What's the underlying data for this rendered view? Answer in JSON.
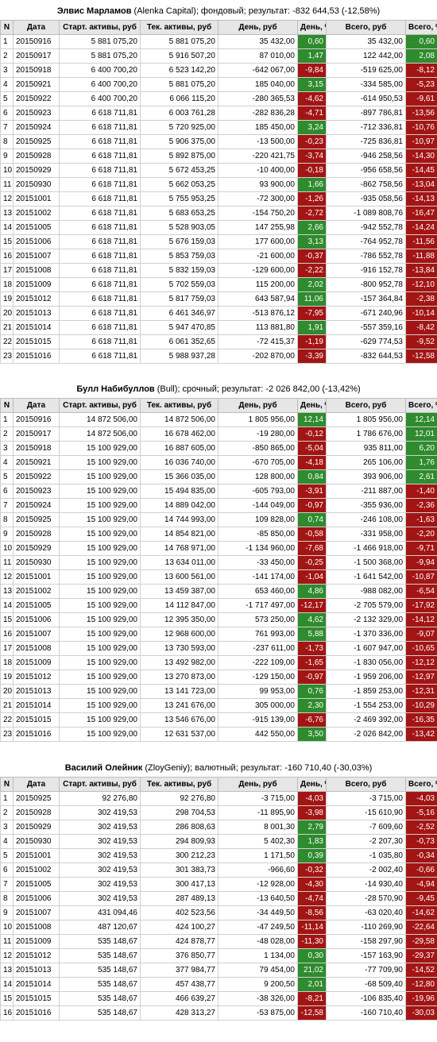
{
  "colors": {
    "positive": "#2e8b2e",
    "negative": "#a31515",
    "header_bg": "#e6e6e6"
  },
  "headers": [
    "N",
    "Дата",
    "Старт. активы, руб",
    "Тек. активы, руб",
    "День, руб",
    "День, %",
    "Всего, руб",
    "Всего, %"
  ],
  "sections": [
    {
      "name": "Элвис Марламов",
      "info": " (Alenka Capital); фондовый; результат: -832 644,53 (-12,58%)",
      "rows": [
        [
          "1",
          "20150916",
          "5 881 075,20",
          "5 881 075,20",
          "35 432,00",
          "0,60",
          "35 432,00",
          "0,60"
        ],
        [
          "2",
          "20150917",
          "5 881 075,20",
          "5 916 507,20",
          "87 010,00",
          "1,47",
          "122 442,00",
          "2,08"
        ],
        [
          "3",
          "20150918",
          "6 400 700,20",
          "6 523 142,20",
          "-642 067,00",
          "-9,84",
          "-519 625,00",
          "-8,12"
        ],
        [
          "4",
          "20150921",
          "6 400 700,20",
          "5 881 075,20",
          "185 040,00",
          "3,15",
          "-334 585,00",
          "-5,23"
        ],
        [
          "5",
          "20150922",
          "6 400 700,20",
          "6 066 115,20",
          "-280 365,53",
          "-4,62",
          "-614 950,53",
          "-9,61"
        ],
        [
          "6",
          "20150923",
          "6 618 711,81",
          "6 003 761,28",
          "-282 836,28",
          "-4,71",
          "-897 786,81",
          "-13,56"
        ],
        [
          "7",
          "20150924",
          "6 618 711,81",
          "5 720 925,00",
          "185 450,00",
          "3,24",
          "-712 336,81",
          "-10,76"
        ],
        [
          "8",
          "20150925",
          "6 618 711,81",
          "5 906 375,00",
          "-13 500,00",
          "-0,23",
          "-725 836,81",
          "-10,97"
        ],
        [
          "9",
          "20150928",
          "6 618 711,81",
          "5 892 875,00",
          "-220 421,75",
          "-3,74",
          "-946 258,56",
          "-14,30"
        ],
        [
          "10",
          "20150929",
          "6 618 711,81",
          "5 672 453,25",
          "-10 400,00",
          "-0,18",
          "-956 658,56",
          "-14,45"
        ],
        [
          "11",
          "20150930",
          "6 618 711,81",
          "5 662 053,25",
          "93 900,00",
          "1,66",
          "-862 758,56",
          "-13,04"
        ],
        [
          "12",
          "20151001",
          "6 618 711,81",
          "5 755 953,25",
          "-72 300,00",
          "-1,26",
          "-935 058,56",
          "-14,13"
        ],
        [
          "13",
          "20151002",
          "6 618 711,81",
          "5 683 653,25",
          "-154 750,20",
          "-2,72",
          "-1 089 808,76",
          "-16,47"
        ],
        [
          "14",
          "20151005",
          "6 618 711,81",
          "5 528 903,05",
          "147 255,98",
          "2,66",
          "-942 552,78",
          "-14,24"
        ],
        [
          "15",
          "20151006",
          "6 618 711,81",
          "5 676 159,03",
          "177 600,00",
          "3,13",
          "-764 952,78",
          "-11,56"
        ],
        [
          "16",
          "20151007",
          "6 618 711,81",
          "5 853 759,03",
          "-21 600,00",
          "-0,37",
          "-786 552,78",
          "-11,88"
        ],
        [
          "17",
          "20151008",
          "6 618 711,81",
          "5 832 159,03",
          "-129 600,00",
          "-2,22",
          "-916 152,78",
          "-13,84"
        ],
        [
          "18",
          "20151009",
          "6 618 711,81",
          "5 702 559,03",
          "115 200,00",
          "2,02",
          "-800 952,78",
          "-12,10"
        ],
        [
          "19",
          "20151012",
          "6 618 711,81",
          "5 817 759,03",
          "643 587,94",
          "11,06",
          "-157 364,84",
          "-2,38"
        ],
        [
          "20",
          "20151013",
          "6 618 711,81",
          "6 461 346,97",
          "-513 876,12",
          "-7,95",
          "-671 240,96",
          "-10,14"
        ],
        [
          "21",
          "20151014",
          "6 618 711,81",
          "5 947 470,85",
          "113 881,80",
          "1,91",
          "-557 359,16",
          "-8,42"
        ],
        [
          "22",
          "20151015",
          "6 618 711,81",
          "6 061 352,65",
          "-72 415,37",
          "-1,19",
          "-629 774,53",
          "-9,52"
        ],
        [
          "23",
          "20151016",
          "6 618 711,81",
          "5 988 937,28",
          "-202 870,00",
          "-3,39",
          "-832 644,53",
          "-12,58"
        ]
      ]
    },
    {
      "name": "Булл Набибуллов",
      "info": " (Bull); срочный; результат: -2 026 842,00 (-13,42%)",
      "rows": [
        [
          "1",
          "20150916",
          "14 872 506,00",
          "14 872 506,00",
          "1 805 956,00",
          "12,14",
          "1 805 956,00",
          "12,14"
        ],
        [
          "2",
          "20150917",
          "14 872 506,00",
          "16 678 462,00",
          "-19 280,00",
          "-0,12",
          "1 786 676,00",
          "12,01"
        ],
        [
          "3",
          "20150918",
          "15 100 929,00",
          "16 887 605,00",
          "-850 865,00",
          "-5,04",
          "935 811,00",
          "6,20"
        ],
        [
          "4",
          "20150921",
          "15 100 929,00",
          "16 036 740,00",
          "-670 705,00",
          "-4,18",
          "265 106,00",
          "1,76"
        ],
        [
          "5",
          "20150922",
          "15 100 929,00",
          "15 366 035,00",
          "128 800,00",
          "0,84",
          "393 906,00",
          "2,61"
        ],
        [
          "6",
          "20150923",
          "15 100 929,00",
          "15 494 835,00",
          "-605 793,00",
          "-3,91",
          "-211 887,00",
          "-1,40"
        ],
        [
          "7",
          "20150924",
          "15 100 929,00",
          "14 889 042,00",
          "-144 049,00",
          "-0,97",
          "-355 936,00",
          "-2,36"
        ],
        [
          "8",
          "20150925",
          "15 100 929,00",
          "14 744 993,00",
          "109 828,00",
          "0,74",
          "-246 108,00",
          "-1,63"
        ],
        [
          "9",
          "20150928",
          "15 100 929,00",
          "14 854 821,00",
          "-85 850,00",
          "-0,58",
          "-331 958,00",
          "-2,20"
        ],
        [
          "10",
          "20150929",
          "15 100 929,00",
          "14 768 971,00",
          "-1 134 960,00",
          "-7,68",
          "-1 466 918,00",
          "-9,71"
        ],
        [
          "11",
          "20150930",
          "15 100 929,00",
          "13 634 011,00",
          "-33 450,00",
          "-0,25",
          "-1 500 368,00",
          "-9,94"
        ],
        [
          "12",
          "20151001",
          "15 100 929,00",
          "13 600 561,00",
          "-141 174,00",
          "-1,04",
          "-1 641 542,00",
          "-10,87"
        ],
        [
          "13",
          "20151002",
          "15 100 929,00",
          "13 459 387,00",
          "653 460,00",
          "4,86",
          "-988 082,00",
          "-6,54"
        ],
        [
          "14",
          "20151005",
          "15 100 929,00",
          "14 112 847,00",
          "-1 717 497,00",
          "-12,17",
          "-2 705 579,00",
          "-17,92"
        ],
        [
          "15",
          "20151006",
          "15 100 929,00",
          "12 395 350,00",
          "573 250,00",
          "4,62",
          "-2 132 329,00",
          "-14,12"
        ],
        [
          "16",
          "20151007",
          "15 100 929,00",
          "12 968 600,00",
          "761 993,00",
          "5,88",
          "-1 370 336,00",
          "-9,07"
        ],
        [
          "17",
          "20151008",
          "15 100 929,00",
          "13 730 593,00",
          "-237 611,00",
          "-1,73",
          "-1 607 947,00",
          "-10,65"
        ],
        [
          "18",
          "20151009",
          "15 100 929,00",
          "13 492 982,00",
          "-222 109,00",
          "-1,65",
          "-1 830 056,00",
          "-12,12"
        ],
        [
          "19",
          "20151012",
          "15 100 929,00",
          "13 270 873,00",
          "-129 150,00",
          "-0,97",
          "-1 959 206,00",
          "-12,97"
        ],
        [
          "20",
          "20151013",
          "15 100 929,00",
          "13 141 723,00",
          "99 953,00",
          "0,76",
          "-1 859 253,00",
          "-12,31"
        ],
        [
          "21",
          "20151014",
          "15 100 929,00",
          "13 241 676,00",
          "305 000,00",
          "2,30",
          "-1 554 253,00",
          "-10,29"
        ],
        [
          "22",
          "20151015",
          "15 100 929,00",
          "13 546 676,00",
          "-915 139,00",
          "-6,76",
          "-2 469 392,00",
          "-16,35"
        ],
        [
          "23",
          "20151016",
          "15 100 929,00",
          "12 631 537,00",
          "442 550,00",
          "3,50",
          "-2 026 842,00",
          "-13,42"
        ]
      ]
    },
    {
      "name": "Василий Олейник",
      "info": " (ZloyGeniy); валютный; результат: -160 710,40 (-30,03%)",
      "rows": [
        [
          "1",
          "20150925",
          "92 276,80",
          "92 276,80",
          "-3 715,00",
          "-4,03",
          "-3 715,00",
          "-4,03"
        ],
        [
          "2",
          "20150928",
          "302 419,53",
          "298 704,53",
          "-11 895,90",
          "-3,98",
          "-15 610,90",
          "-5,16"
        ],
        [
          "3",
          "20150929",
          "302 419,53",
          "286 808,63",
          "8 001,30",
          "2,79",
          "-7 609,60",
          "-2,52"
        ],
        [
          "4",
          "20150930",
          "302 419,53",
          "294 809,93",
          "5 402,30",
          "1,83",
          "-2 207,30",
          "-0,73"
        ],
        [
          "5",
          "20151001",
          "302 419,53",
          "300 212,23",
          "1 171,50",
          "0,39",
          "-1 035,80",
          "-0,34"
        ],
        [
          "6",
          "20151002",
          "302 419,53",
          "301 383,73",
          "-966,60",
          "-0,32",
          "-2 002,40",
          "-0,66"
        ],
        [
          "7",
          "20151005",
          "302 419,53",
          "300 417,13",
          "-12 928,00",
          "-4,30",
          "-14 930,40",
          "-4,94"
        ],
        [
          "8",
          "20151006",
          "302 419,53",
          "287 489,13",
          "-13 640,50",
          "-4,74",
          "-28 570,90",
          "-9,45"
        ],
        [
          "9",
          "20151007",
          "431 094,46",
          "402 523,56",
          "-34 449,50",
          "-8,56",
          "-63 020,40",
          "-14,62"
        ],
        [
          "10",
          "20151008",
          "487 120,67",
          "424 100,27",
          "-47 249,50",
          "-11,14",
          "-110 269,90",
          "-22,64"
        ],
        [
          "11",
          "20151009",
          "535 148,67",
          "424 878,77",
          "-48 028,00",
          "-11,30",
          "-158 297,90",
          "-29,58"
        ],
        [
          "12",
          "20151012",
          "535 148,67",
          "376 850,77",
          "1 134,00",
          "0,30",
          "-157 163,90",
          "-29,37"
        ],
        [
          "13",
          "20151013",
          "535 148,67",
          "377 984,77",
          "79 454,00",
          "21,02",
          "-77 709,90",
          "-14,52"
        ],
        [
          "14",
          "20151014",
          "535 148,67",
          "457 438,77",
          "9 200,50",
          "2,01",
          "-68 509,40",
          "-12,80"
        ],
        [
          "15",
          "20151015",
          "535 148,67",
          "466 639,27",
          "-38 326,00",
          "-8,21",
          "-106 835,40",
          "-19,96"
        ],
        [
          "16",
          "20151016",
          "535 148,67",
          "428 313,27",
          "-53 875,00",
          "-12,58",
          "-160 710,40",
          "-30,03"
        ]
      ]
    }
  ]
}
